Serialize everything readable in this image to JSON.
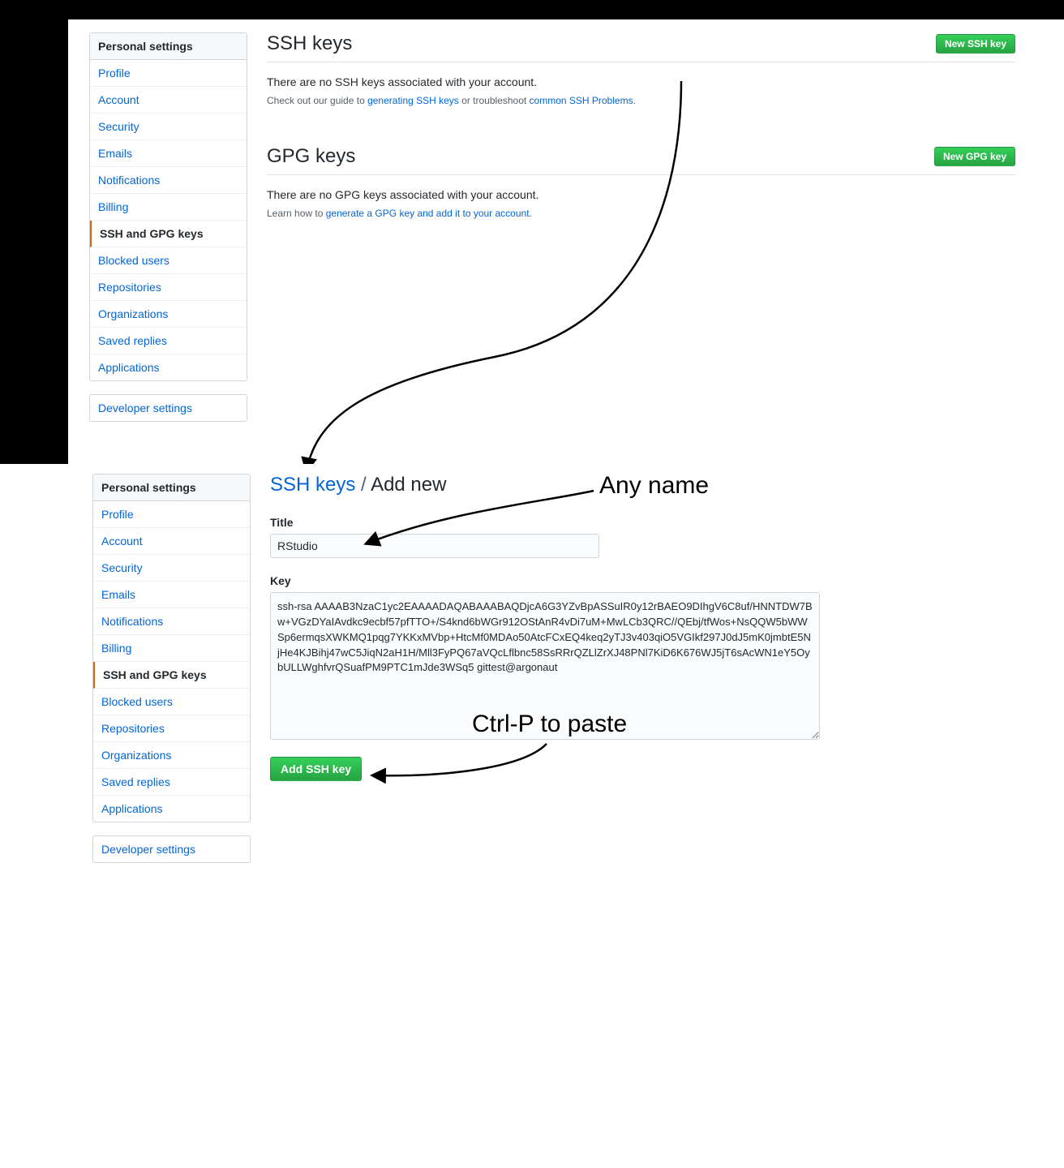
{
  "sidebar": {
    "header": "Personal settings",
    "items": [
      "Profile",
      "Account",
      "Security",
      "Emails",
      "Notifications",
      "Billing",
      "SSH and GPG keys",
      "Blocked users",
      "Repositories",
      "Organizations",
      "Saved replies",
      "Applications"
    ],
    "developer": "Developer settings",
    "active_index": 6
  },
  "ssh": {
    "heading": "SSH keys",
    "new_button": "New SSH key",
    "empty_text": "There are no SSH keys associated with your account.",
    "help_prefix": "Check out our guide to ",
    "help_link1": "generating SSH keys",
    "help_mid": " or troubleshoot ",
    "help_link2": "common SSH Problems",
    "help_suffix": "."
  },
  "gpg": {
    "heading": "GPG keys",
    "new_button": "New GPG key",
    "empty_text": "There are no GPG keys associated with your account.",
    "help_prefix": "Learn how to ",
    "help_link": "generate a GPG key and add it to your account",
    "help_suffix": "."
  },
  "add_new": {
    "breadcrumb_link": "SSH keys",
    "breadcrumb_sep": " / ",
    "breadcrumb_current": "Add new",
    "title_label": "Title",
    "title_value": "RStudio",
    "key_label": "Key",
    "key_value": "ssh-rsa AAAAB3NzaC1yc2EAAAADAQABAAABAQDjcA6G3YZvBpASSuIR0y12rBAEO9DIhgV6C8uf/HNNTDW7Bw+VGzDYaIAvdkc9ecbf57pfTTO+/S4knd6bWGr912OStAnR4vDi7uM+MwLCb3QRC//QEbj/tfWos+NsQQW5bWWSp6ermqsXWKMQ1pqg7YKKxMVbp+HtcMf0MDAo50AtcFCxEQ4keq2yTJ3v403qiO5VGIkf297J0dJ5mK0jmbtE5NjHe4KJBihj47wC5JiqN2aH1H/Mll3FyPQ67aVQcLflbnc58SsRRrQZLlZrXJ48PNl7KiD6K676WJ5jT6sAcWN1eY5OybULLWghfvrQSuafPM9PTC1mJde3WSq5 gittest@argonaut",
    "submit_button": "Add SSH key"
  },
  "annotations": {
    "any_name": "Any name",
    "paste": "Ctrl-P to paste"
  }
}
